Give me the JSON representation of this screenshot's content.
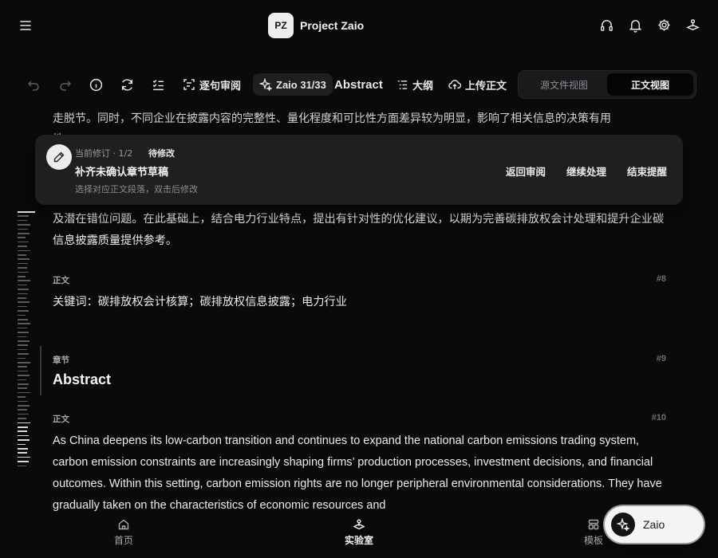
{
  "header": {
    "avatar_initials": "PZ",
    "project_name": "Project Zaio",
    "icons": [
      "menu-icon",
      "headphones-icon",
      "bell-icon",
      "gear-icon",
      "joystick-icon"
    ]
  },
  "toolbar": {
    "sentence_review": "逐句审阅",
    "zaio_counter": "Zaio 31/33",
    "section_title": "Abstract",
    "outline": "大纲",
    "upload_body": "上传正文",
    "view_source": "源文件视图",
    "view_body": "正文视图",
    "active_view": "正文视图"
  },
  "revision": {
    "meta": "当前修订 · 1/2",
    "status": "待修改",
    "title": "补齐未确认章节草稿",
    "hint": "选择对应正文段落，双击后修改",
    "actions": [
      "返回审阅",
      "继续处理",
      "结束提醒"
    ]
  },
  "document": {
    "cut_line_1": "走脱节。同时，不同企业在披露内容的完整性、量化程度和可比性方面差异较为明显，影响了相关信息的决策有用",
    "cut_line_2": "性。",
    "para7": "及潜在错位问题。在此基础上，结合电力行业特点，提出有针对性的优化建议，以期为完善碳排放权会计处理和提升企业碳信息披露质量提供参考。",
    "blocks": [
      {
        "label": "正文",
        "num": "#8",
        "text": "关键词：碳排放权会计核算；碳排放权信息披露；电力行业"
      },
      {
        "label": "章节",
        "num": "#9",
        "text": "Abstract"
      },
      {
        "label": "正文",
        "num": "#10",
        "text": "As China deepens its low-carbon transition and continues to expand the national carbon emissions trading system, carbon emission constraints are increasingly shaping firms’ production processes, investment decisions, and financial outcomes. Within this setting, carbon emission rights are no longer peripheral environmental considerations. They have gradually taken on the characteristics of economic resources and"
      }
    ]
  },
  "bottom_nav": {
    "items": [
      {
        "label": "首页",
        "icon": "home-icon"
      },
      {
        "label": "实验室",
        "icon": "joystick-icon",
        "active": true
      },
      {
        "label": "模板",
        "icon": "template-icon"
      }
    ],
    "fab_label": "Zaio"
  }
}
